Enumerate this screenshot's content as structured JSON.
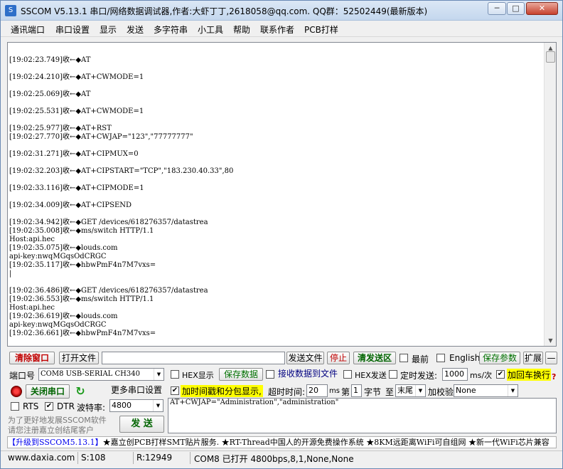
{
  "window": {
    "title": "SSCOM V5.13.1 串口/网络数据调试器,作者:大虾丁丁,2618058@qq.com. QQ群：52502449(最新版本)",
    "icon_name": "sscom-app-icon",
    "min_glyph": "─",
    "max_glyph": "□",
    "close_glyph": "✕"
  },
  "menu": {
    "items": [
      "通讯端口",
      "串口设置",
      "显示",
      "发送",
      "多字符串",
      "小工具",
      "帮助",
      "联系作者",
      "PCB打样"
    ]
  },
  "receive": {
    "lines": [
      "",
      "[19:02:23.749]收←◆AT",
      "",
      "[19:02:24.210]收←◆AT+CWMODE=1",
      "",
      "[19:02:25.069]收←◆AT",
      "",
      "[19:02:25.531]收←◆AT+CWMODE=1",
      "",
      "[19:02:25.977]收←◆AT+RST",
      "[19:02:27.770]收←◆AT+CWJAP=\"123\",\"77777777\"",
      "",
      "[19:02:31.271]收←◆AT+CIPMUX=0",
      "",
      "[19:02:32.203]收←◆AT+CIPSTART=\"TCP\",\"183.230.40.33\",80",
      "",
      "[19:02:33.116]收←◆AT+CIPMODE=1",
      "",
      "[19:02:34.009]收←◆AT+CIPSEND",
      "",
      "[19:02:34.942]收←◆GET /devices/618276357/datastrea",
      "[19:02:35.008]收←◆ms/switch HTTP/1.1",
      "Host:api.hec",
      "[19:02:35.075]收←◆louds.com",
      "api-key:nwqMGqsOdCRGC",
      "[19:02:35.117]收←◆hbwPmF4n7M7vxs=",
      "|",
      "",
      "[19:02:36.486]收←◆GET /devices/618276357/datastrea",
      "[19:02:36.553]收←◆ms/switch HTTP/1.1",
      "Host:api.hec",
      "[19:02:36.619]收←◆louds.com",
      "api-key:nwqMGqsOdCRGC",
      "[19:02:36.661]收←◆hbwPmF4n7M7vxs="
    ]
  },
  "toolbar1": {
    "clear_window": "清除窗口",
    "open_file": "打开文件",
    "file_path": "",
    "send_file": "发送文件",
    "stop": "停止",
    "clear_send": "清发送区",
    "last": "最前",
    "english": "English",
    "save_params": "保存参数",
    "expand": "扩展",
    "collapse": "—"
  },
  "port": {
    "label": "端口号",
    "value": "COM8 USB-SERIAL CH340",
    "hex_display": "HEX显示",
    "save_data": "保存数据",
    "recv_to_file": "接收数据到文件",
    "hex_send": "HEX发送",
    "timed_send": "定时发送:",
    "interval": "1000",
    "interval_unit": "ms/次",
    "add_crlf": "加回车换行",
    "help_mark": "?"
  },
  "port2": {
    "close_port": "关闭串口",
    "refresh_icon": "refresh-icon",
    "more_settings": "更多串口设置",
    "timestamp": "加时间戳和分包显示,",
    "timeout_label": "超时时间:",
    "timeout": "20",
    "timeout_unit": "ms",
    "nth_label": "第",
    "nth": "1",
    "byte_label": "字节",
    "to_label": "至",
    "tail": "末尾",
    "checksum_label": "加校验",
    "checksum": "None"
  },
  "port3": {
    "rts": "RTS",
    "dtr": "DTR",
    "baud_label": "波特率:",
    "baud": "4800"
  },
  "send": {
    "text": "AT+CWJAP=\"Administration\",\"administration\"",
    "promo1": "为了更好地发展SSCOM软件",
    "promo2": "请您注册嘉立创结尾客户",
    "send_button": "发  送"
  },
  "ticker": {
    "link": "【升级到SSCOM5.13.1】",
    "text": "★嘉立创PCB打样SMT贴片服务. ★RT-Thread中国人的开源免费操作系统 ★8KM远距离WiFi可自组网 ★新一代WiFi芯片兼容"
  },
  "status": {
    "site": "www.daxia.com",
    "sent": "S:108",
    "received": "R:12949",
    "port_state": "COM8 已打开  4800bps,8,1,None,None"
  },
  "colors": {
    "accent_red": "#c00000",
    "accent_green": "#007000",
    "highlight": "#ffff00"
  }
}
